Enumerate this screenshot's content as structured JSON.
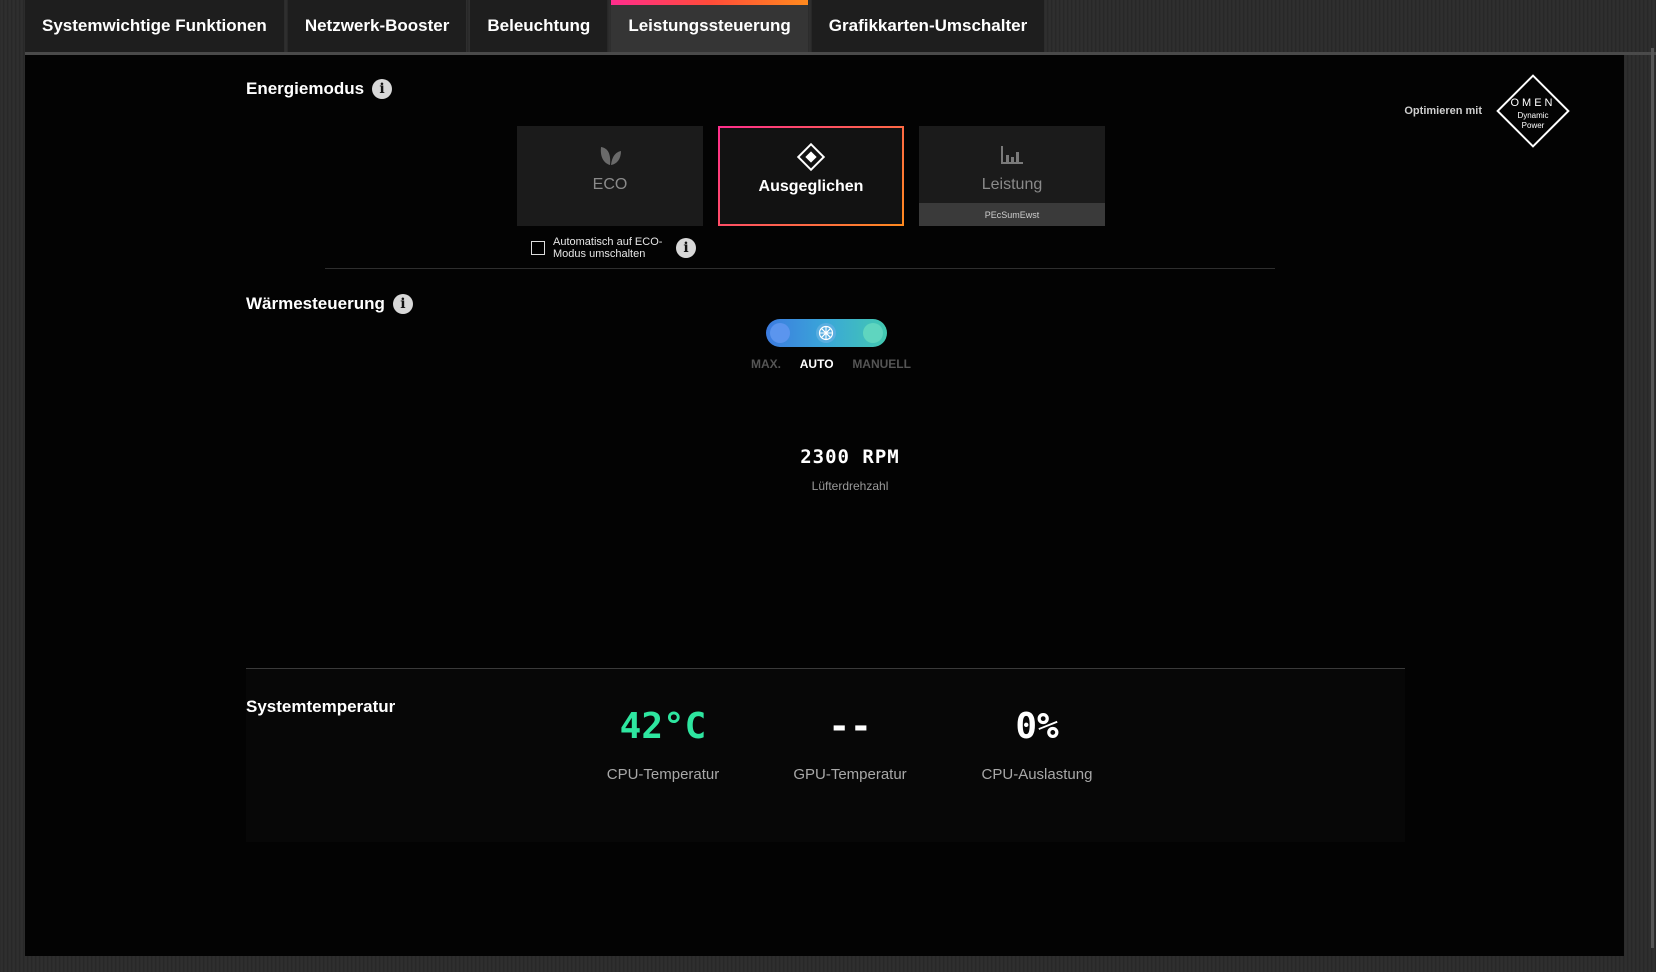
{
  "tabs": [
    {
      "label": "Systemwichtige Funktionen",
      "active": false
    },
    {
      "label": "Netzwerk-Booster",
      "active": false
    },
    {
      "label": "Beleuchtung",
      "active": false
    },
    {
      "label": "Leistungssteuerung",
      "active": true
    },
    {
      "label": "Grafikkarten-Umschalter",
      "active": false
    }
  ],
  "energy": {
    "title": "Energiemodus",
    "modes": {
      "eco": "ECO",
      "balanced": "Ausgeglichen",
      "performance": "Leistung",
      "performance_badge": "PEcSumEwst"
    },
    "selected": "Ausgeglichen",
    "auto_eco_label": "Automatisch auf ECO-Modus umschalten",
    "auto_eco_checked": false
  },
  "omen": {
    "optimize_label": "Optimieren mit",
    "logo_text": "OMEN",
    "logo_sub1": "Dynamic",
    "logo_sub2": "Power"
  },
  "thermal": {
    "title": "Wärmesteuerung",
    "options": [
      "MAX.",
      "AUTO",
      "MANUELL"
    ],
    "selected": "AUTO",
    "fan_speed": "2300 RPM",
    "fan_label": "Lüfterdrehzahl"
  },
  "system_temp": {
    "title": "Systemtemperatur",
    "cpu_temp": "42°C",
    "cpu_temp_label": "CPU-Temperatur",
    "gpu_temp": "--",
    "gpu_temp_label": "GPU-Temperatur",
    "cpu_load": "0%",
    "cpu_load_label": "CPU-Auslastung"
  },
  "colors": {
    "accent_start": "#ff2d8d",
    "accent_end": "#ff8a1e",
    "cpu_temp_color": "#2ee6a0"
  }
}
